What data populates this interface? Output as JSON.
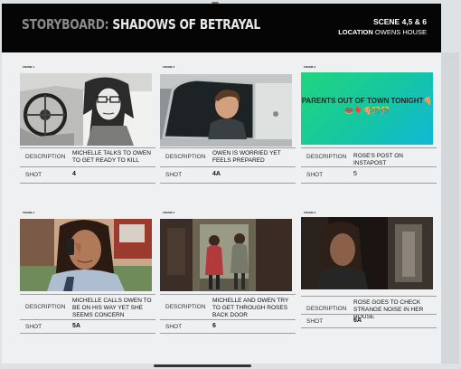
{
  "header": {
    "title_prefix": "STORYBOARD:",
    "title_main": "SHADOWS OF BETRAYAL",
    "scene": "SCENE 4,5 & 6",
    "location_label": "LOCATION",
    "location_value": "OWENS HOUSE"
  },
  "labels": {
    "description": "DESCRIPTION",
    "shot": "SHOT"
  },
  "frames": [
    {
      "frame_label": "FRAME 1",
      "description": "MICHELLE TALKS TO OWEN TO GET READY TO KILL",
      "shot": "4"
    },
    {
      "frame_label": "FRAME 2",
      "description": "OWEN IS WORRIED YET FEELS PREPARED",
      "shot": "4A"
    },
    {
      "frame_label": "FRAME 3",
      "description": "ROSE'S POST ON INSTAPOST",
      "shot": "5",
      "image_text": "PARENTS OUT OF TOWN TONIGHT🍕🍩🎈🍕🎊🎊"
    },
    {
      "frame_label": "FRAME 4",
      "description": "MICHELLE CALLS OWEN TO BE ON HIS WAY YET SHE SEEMS CONCERN",
      "shot": "5A"
    },
    {
      "frame_label": "FRAME 5",
      "description": "MICHELLE AND OWEN TRY TO GET THROUGH ROSES BACK DOOR",
      "shot": "6"
    },
    {
      "frame_label": "FRAME 6",
      "description": "ROSE GOES TO CHECK STRANGE NOISE IN HER HOUSE",
      "shot": "6A"
    }
  ],
  "colors": {
    "header_bg": "#050505",
    "poster_gradient_start": "#21d57f",
    "poster_gradient_end": "#10b8d6"
  }
}
